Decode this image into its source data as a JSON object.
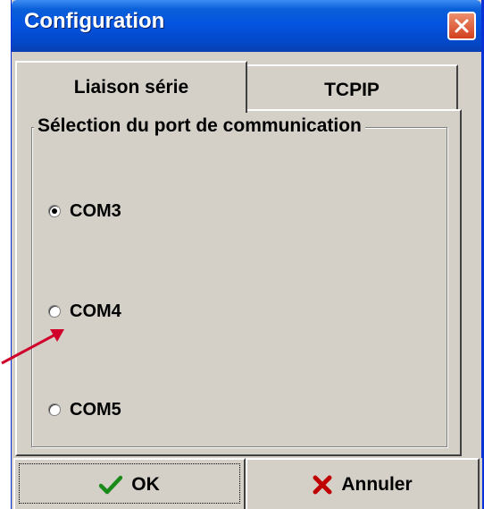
{
  "window": {
    "title": "Configuration"
  },
  "tabs": [
    {
      "label": "Liaison série",
      "active": true
    },
    {
      "label": "TCPIP",
      "active": false
    }
  ],
  "group": {
    "title": "Sélection du port de communication",
    "options": [
      {
        "label": "COM3",
        "checked": true
      },
      {
        "label": "COM4",
        "checked": false
      },
      {
        "label": "COM5",
        "checked": false
      }
    ]
  },
  "buttons": {
    "ok_label": "OK",
    "cancel_label": "Annuler"
  },
  "colors": {
    "titlebar": "#0454e0",
    "face": "#d4d0c8",
    "close": "#d2401d",
    "ok_icon": "#1a8a1a",
    "cancel_icon": "#c00000",
    "annotation_arrow": "#d0002a"
  },
  "icons": {
    "close": "close-icon",
    "ok": "checkmark-icon",
    "cancel": "x-icon",
    "annotation": "arrow-icon"
  }
}
